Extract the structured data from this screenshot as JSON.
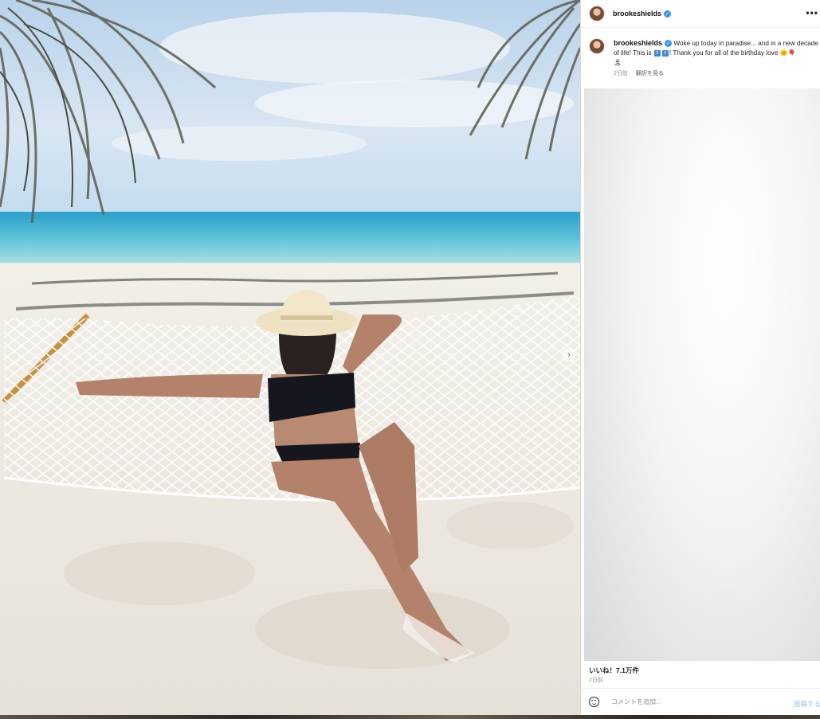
{
  "post": {
    "username": "brookeshields",
    "caption_line1": "Woke up today in paradise... and in a new decade",
    "caption_line2_a": "of life! This is",
    "caption_flag1": "5",
    "caption_flag2": "0",
    "caption_line2_b": "! Thank you for all of the birthday love",
    "time_ago": "2日前",
    "translate_label": "翻訳を見る",
    "likes_label": "いいね！7.1万件",
    "posted_time": "2日前"
  },
  "comment_bar": {
    "placeholder": "コメントを追加...",
    "post_label": "投稿する"
  },
  "icons": {
    "more": "more-options-icon",
    "carousel": "chevron-right-icon",
    "emoji": "emoji-icon",
    "verified": "verified-badge-icon"
  },
  "colors": {
    "verified": "#3897f0",
    "post_button": "#8fc1f3"
  }
}
